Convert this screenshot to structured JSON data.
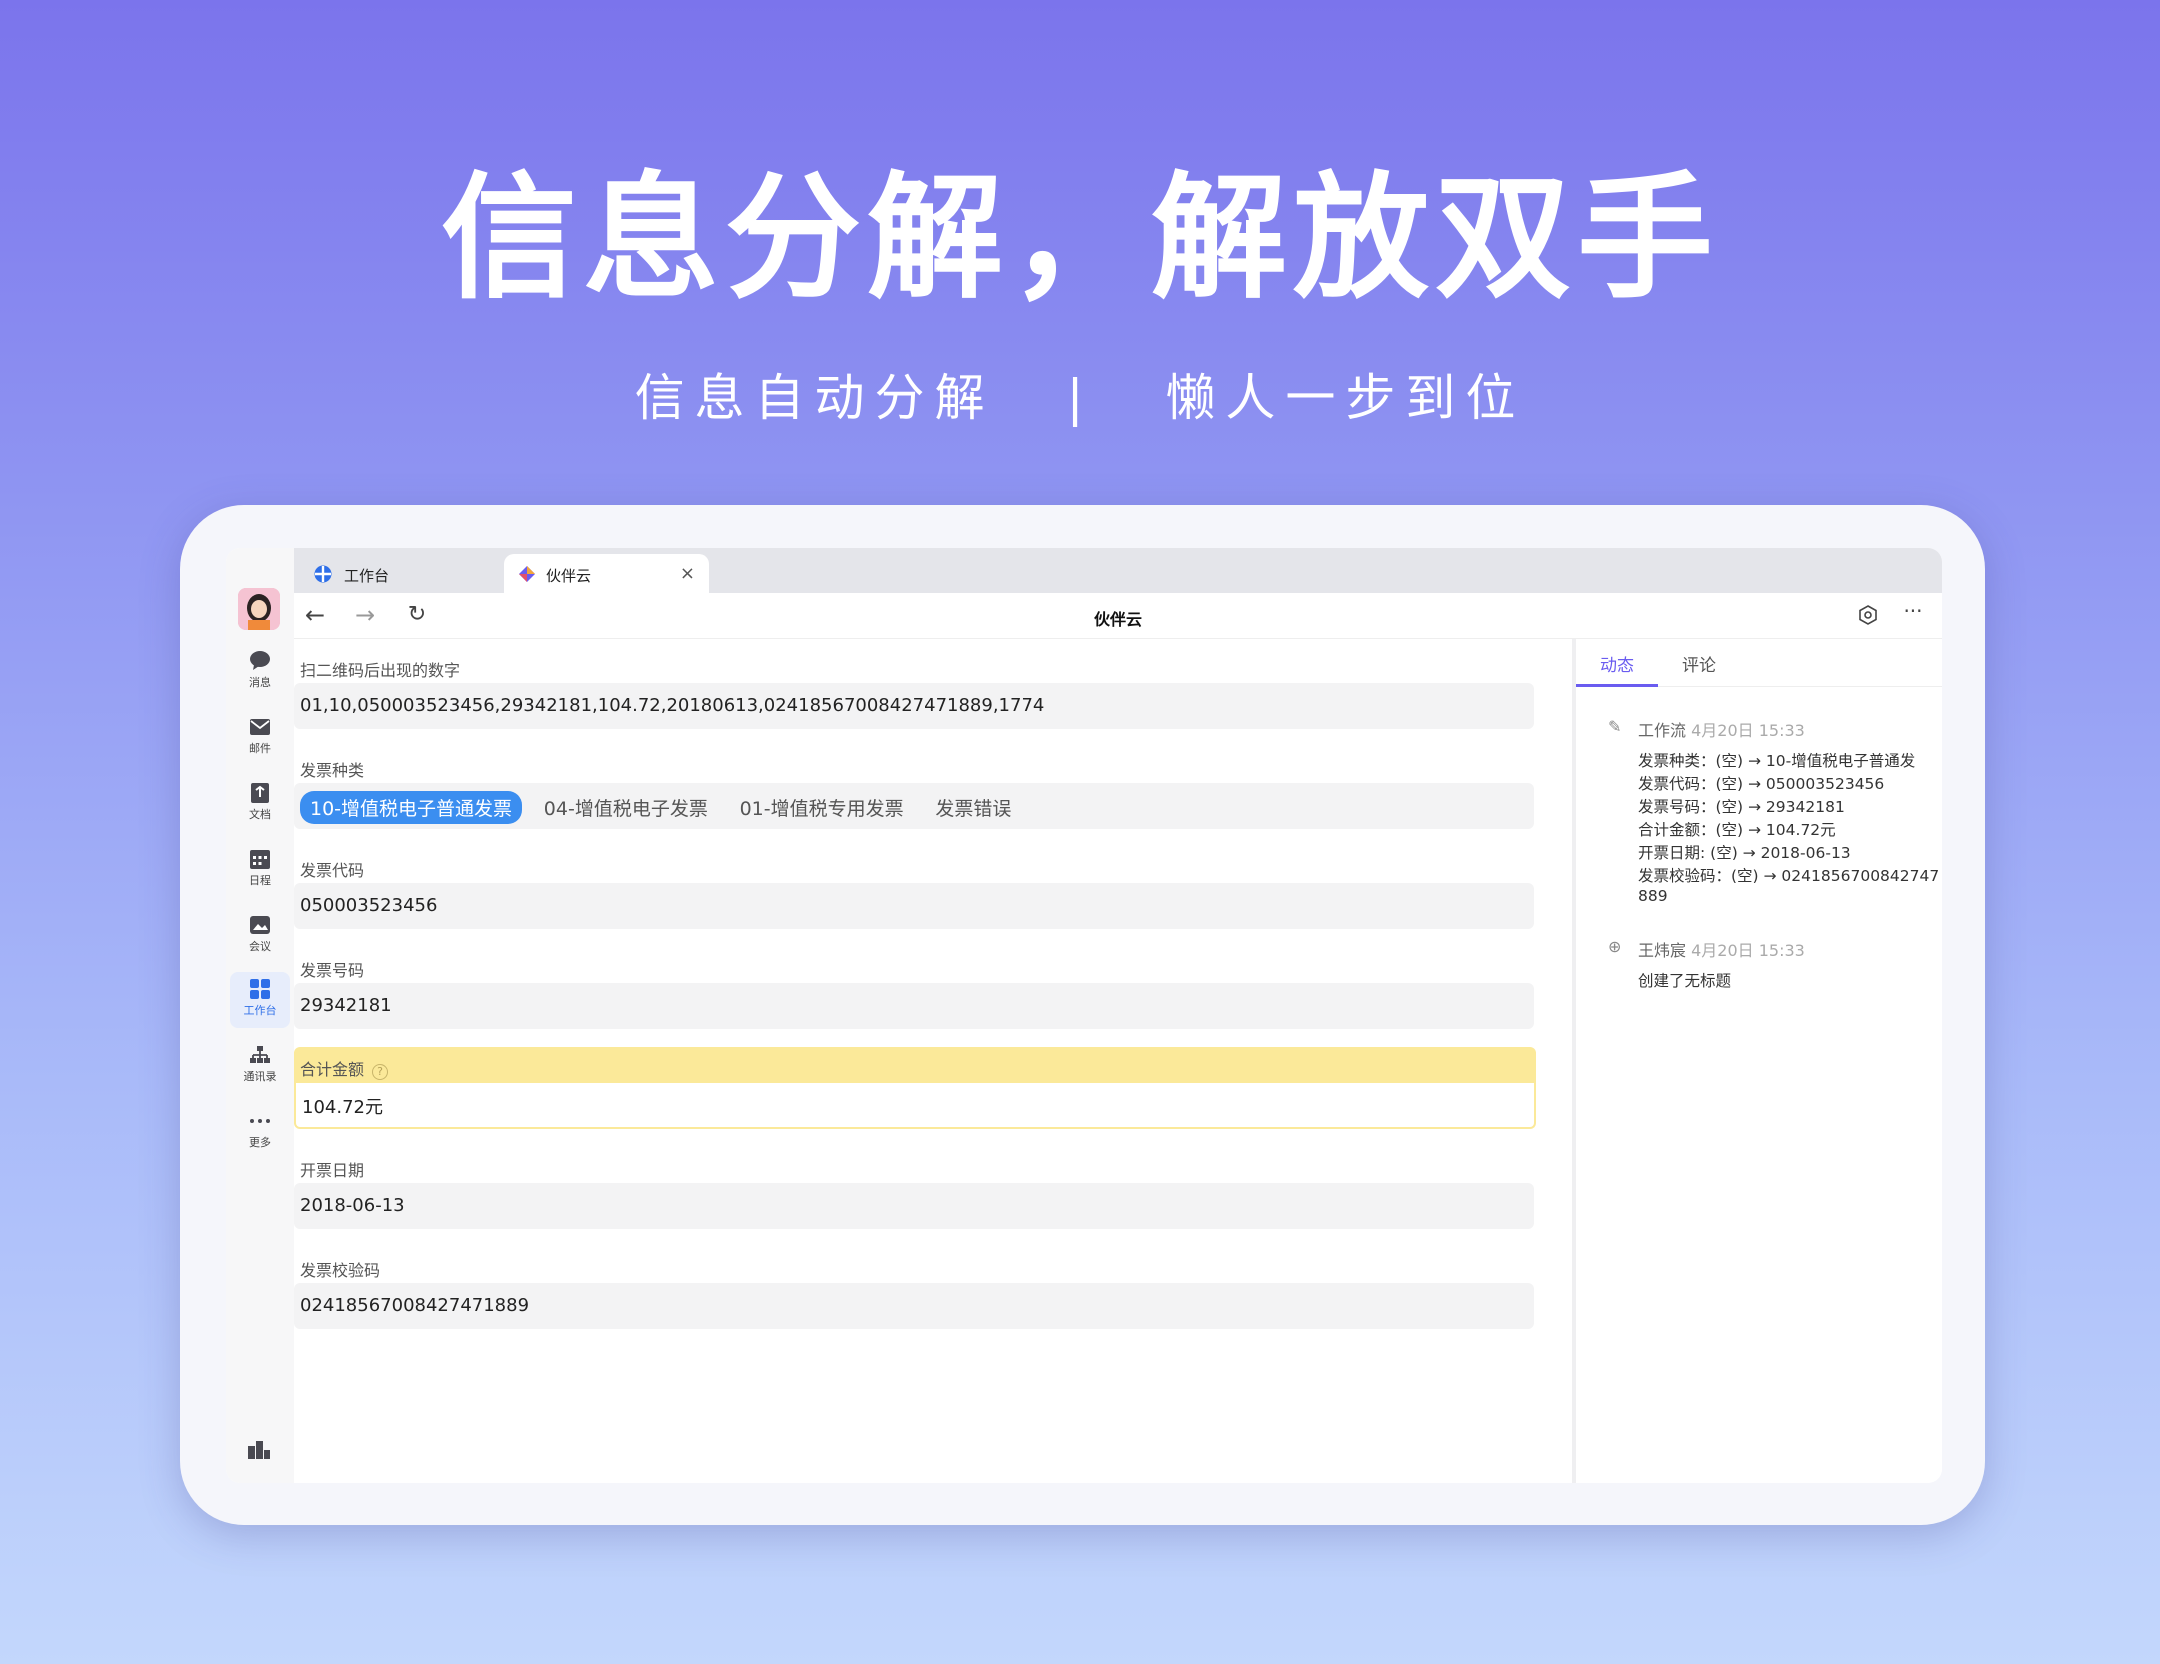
{
  "hero": {
    "title": "信息分解，解放双手",
    "subtitle_left": "信息自动分解",
    "subtitle_sep": "|",
    "subtitle_right": "懒人一步到位"
  },
  "rail": {
    "items": [
      {
        "label": "消息",
        "icon": "chat-bubble-icon"
      },
      {
        "label": "邮件",
        "icon": "mail-icon"
      },
      {
        "label": "文档",
        "icon": "document-icon"
      },
      {
        "label": "日程",
        "icon": "calendar-icon"
      },
      {
        "label": "会议",
        "icon": "meeting-icon"
      },
      {
        "label": "工作台",
        "icon": "workbench-grid-icon"
      },
      {
        "label": "通讯录",
        "icon": "org-chart-icon"
      },
      {
        "label": "更多",
        "icon": "more-dots-icon"
      }
    ],
    "active_index": 5
  },
  "tabs": [
    {
      "label": "工作台"
    },
    {
      "label": "伙伴云"
    }
  ],
  "navbar": {
    "title": "伙伴云"
  },
  "form": {
    "qr_label": "扫二维码后出现的数字",
    "qr_value": "01,10,050003523456,29342181,104.72,20180613,02418567008427471889,1774",
    "type_label": "发票种类",
    "type_options": [
      "10-增值税电子普通发票",
      "04-增值税电子发票",
      "01-增值税专用发票",
      "发票错误"
    ],
    "code_label": "发票代码",
    "code_value": "050003523456",
    "number_label": "发票号码",
    "number_value": "29342181",
    "amount_label": "合计金额",
    "amount_help": "?",
    "amount_value": "104.72元",
    "date_label": "开票日期",
    "date_value": "2018-06-13",
    "check_label": "发票校验码",
    "check_value": "02418567008427471889"
  },
  "side": {
    "tab_activity": "动态",
    "tab_comments": "评论",
    "entry1": {
      "author": "工作流",
      "time": "4月20日 15:33",
      "lines": [
        "发票种类：(空) → 10-增值税电子普通发",
        "发票代码：(空) → 050003523456",
        "发票号码：(空) → 29342181",
        "合计金额：(空) → 104.72元",
        "开票日期: (空) → 2018-06-13",
        "发票校验码：(空) → 0241856700842747",
        "889"
      ]
    },
    "entry2": {
      "author": "王炜宸",
      "time": "4月20日 15:33",
      "text": "创建了无标题"
    }
  },
  "colors": {
    "accent_blue": "#3b8ef0",
    "accent_purple": "#6a5cf0",
    "highlight_yellow": "#fbe999"
  }
}
